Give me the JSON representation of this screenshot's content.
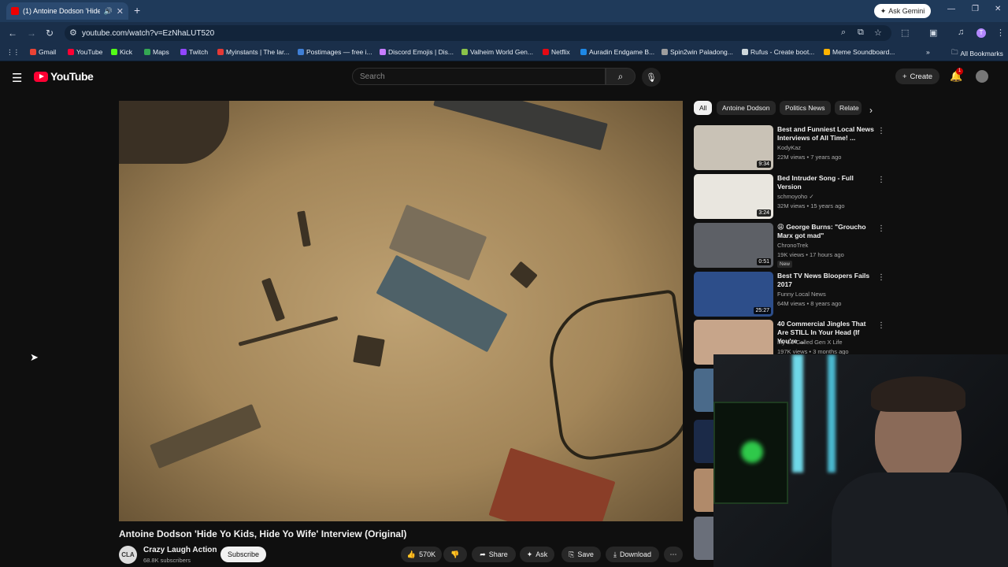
{
  "browser": {
    "tab_title": "(1) Antoine Dodson 'Hide Yo",
    "url": "youtube.com/watch?v=EzNhaLUT520",
    "ask_gemini": "Ask Gemini",
    "all_bookmarks": "All Bookmarks",
    "bookmarks": [
      {
        "label": "Gmail",
        "color": "#ea4335"
      },
      {
        "label": "YouTube",
        "color": "#ff0033"
      },
      {
        "label": "Kick",
        "color": "#53fc18"
      },
      {
        "label": "Maps",
        "color": "#34a853"
      },
      {
        "label": "Twitch",
        "color": "#9146ff"
      },
      {
        "label": "Myinstants | The lar...",
        "color": "#e53935"
      },
      {
        "label": "Postimages — free i...",
        "color": "#3f7fd6"
      },
      {
        "label": "Discord Emojis | Dis...",
        "color": "#c77dff"
      },
      {
        "label": "Valheim World Gen...",
        "color": "#8bc34a"
      },
      {
        "label": "Netflix",
        "color": "#e50914"
      },
      {
        "label": "Auradin Endgame B...",
        "color": "#1e88e5"
      },
      {
        "label": "Spin2win Paladong...",
        "color": "#9e9e9e"
      },
      {
        "label": "Rufus - Create boot...",
        "color": "#cfd8dc"
      },
      {
        "label": "Meme Soundboard...",
        "color": "#ffb300"
      }
    ]
  },
  "youtube": {
    "logo": "YouTube",
    "search_placeholder": "Search",
    "create_label": "Create",
    "notif_count": "1",
    "video_title": "Antoine Dodson 'Hide Yo Kids, Hide Yo Wife' Interview (Original)",
    "channel": {
      "avatar_text": "CLA",
      "name": "Crazy Laugh Action",
      "subs": "68.8K subscribers"
    },
    "subscribe_label": "Subscribe",
    "actions": {
      "likes": "570K",
      "share": "Share",
      "ask": "Ask",
      "save": "Save",
      "download": "Download"
    },
    "chips": [
      "All",
      "Antoine Dodson",
      "Politics News",
      "Relate"
    ],
    "recommendations": [
      {
        "title": "Best and Funniest Local News Interviews of All Time! ...",
        "channel": "KodyKaz",
        "meta": "22M views • 7 years ago",
        "duration": "9:34",
        "thumb_color": "#c9c2b6"
      },
      {
        "title": "Bed Intruder Song - Full Version",
        "channel": "schmoyoho ✓",
        "meta": "32M views • 15 years ago",
        "duration": "3:24",
        "thumb_color": "#e9e6df"
      },
      {
        "title": "😩 George Burns: \"Groucho Marx got mad\"",
        "channel": "ChronoTrek",
        "meta": "19K views • 17 hours ago",
        "duration": "0:51",
        "badge": "New",
        "thumb_color": "#5d6066"
      },
      {
        "title": "Best TV News Bloopers Fails 2017",
        "channel": "Funny Local News",
        "meta": "64M views • 8 years ago",
        "duration": "25:27",
        "thumb_color": "#2d4e8a"
      },
      {
        "title": "40 Commercial Jingles That Are STILL In Your Head (If You're ...",
        "channel": "My So-Called Gen X Life",
        "meta": "197K views • 3 months ago",
        "duration": "",
        "thumb_color": "#c7a58a"
      }
    ]
  }
}
